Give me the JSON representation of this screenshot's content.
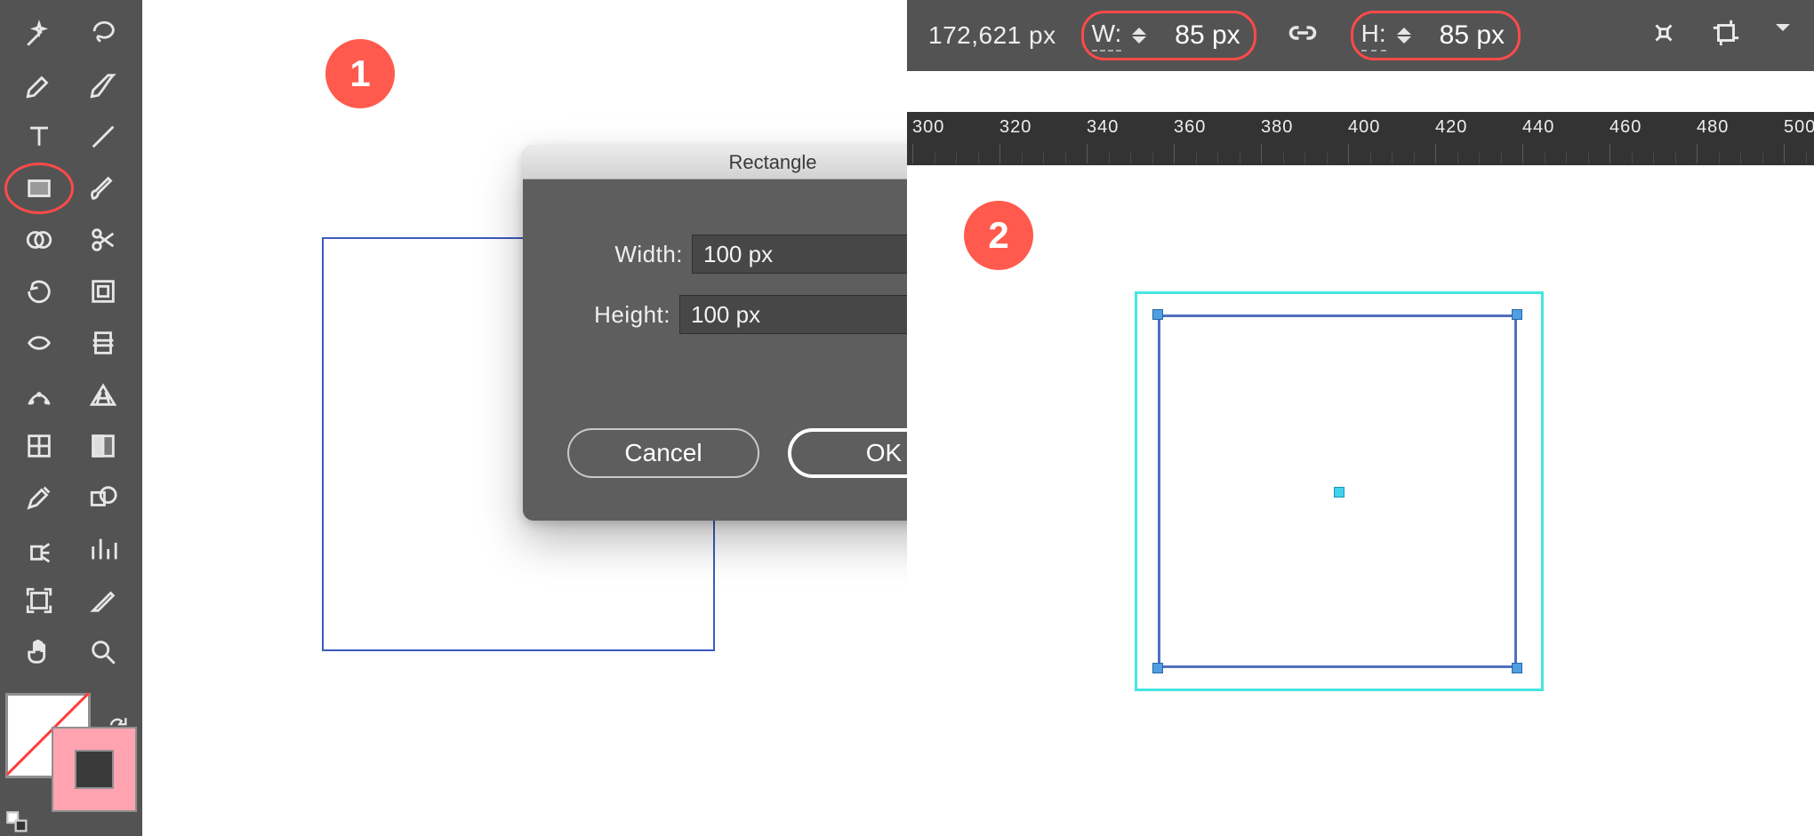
{
  "tools": {
    "magic_wand": "magic-wand-tool",
    "lasso": "lasso-tool",
    "pen": "pen-tool",
    "curvature": "curvature-tool",
    "type": "type-tool",
    "line": "line-tool",
    "rectangle": "rectangle-tool",
    "paintbrush": "paintbrush-tool",
    "shape_builder": "shape-builder-tool",
    "scissors": "scissors-tool",
    "rotate": "rotate-tool",
    "scale": "free-transform-tool",
    "width": "width-tool",
    "warp": "warp-tool",
    "free_transform": "puppet-warp-tool",
    "perspective": "perspective-grid-tool",
    "mesh": "mesh-tool",
    "gradient": "gradient-tool",
    "eyedropper": "eyedropper-tool",
    "blend": "blend-tool",
    "symbol_sprayer": "symbol-sprayer-tool",
    "graph": "column-graph-tool",
    "artboard": "artboard-tool",
    "slice": "slice-tool",
    "hand": "hand-tool",
    "zoom": "zoom-tool"
  },
  "dialog": {
    "title": "Rectangle",
    "width_label": "Width:",
    "height_label": "Height:",
    "width_value": "100 px",
    "height_value": "100 px",
    "cancel": "Cancel",
    "ok": "OK"
  },
  "badges": {
    "one": "1",
    "two": "2"
  },
  "properties": {
    "x_value": "172,621 px",
    "w_label": "W:",
    "h_label": "H:",
    "w_value": "85 px",
    "h_value": "85 px"
  },
  "ruler_ticks": [
    "300",
    "320",
    "340",
    "360",
    "380",
    "400",
    "420",
    "440",
    "460",
    "480",
    "500"
  ]
}
